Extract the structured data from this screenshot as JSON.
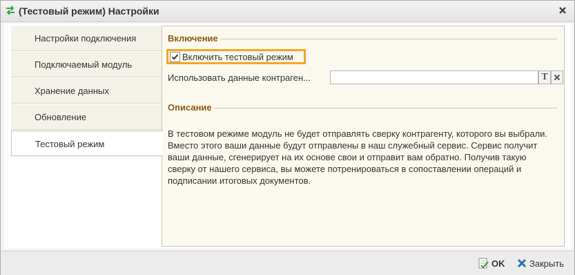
{
  "window": {
    "title": "(Тестовый режим) Настройки",
    "title_icon": "arrows-exchange-icon",
    "close_icon": "close-icon"
  },
  "tabs": [
    {
      "label": "Настройки подключения",
      "active": false
    },
    {
      "label": "Подключаемый модуль",
      "active": false
    },
    {
      "label": "Хранение данных",
      "active": false
    },
    {
      "label": "Обновление",
      "active": false
    },
    {
      "label": "Тестовый режим",
      "active": true
    }
  ],
  "panel": {
    "enable_group_title": "Включение",
    "test_mode_checkbox": {
      "label": "Включить тестовый режим",
      "checked": true
    },
    "contractor_field": {
      "label": "Использовать данные контраген...",
      "value": ""
    },
    "description_group_title": "Описание",
    "description_text": "В тестовом режиме модуль не будет отправлять сверку контрагенту, которого вы выбрали. Вместо этого ваши данные будут отправлены в наш служебный сервис. Сервис получит ваши данные, сгенерирует на их основе свои и отправит вам обратно. Получив такую сверку от нашего сервиса, вы можете потренироваться в сопоставлении операций и подписании итоговых документов.",
    "type_button": "T"
  },
  "footer": {
    "ok_label": "OK",
    "close_label": "Закрыть"
  },
  "colors": {
    "accent_highlight": "#f5a623",
    "group_title": "#8b5a12",
    "title_icon": "#3aa43a",
    "close_x_blue": "#2f6fb5"
  }
}
